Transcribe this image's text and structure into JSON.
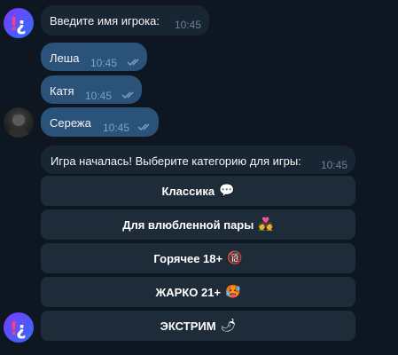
{
  "messages": {
    "prompt": {
      "text": "Введите имя игрока:",
      "time": "10:45"
    },
    "players": [
      {
        "text": "Леша",
        "time": "10:45"
      },
      {
        "text": "Катя",
        "time": "10:45"
      },
      {
        "text": "Сережа",
        "time": "10:45"
      }
    ],
    "start": {
      "text": "Игра началась! Выберите категорию для игры:",
      "time": "10:45"
    }
  },
  "keyboard": {
    "buttons": [
      {
        "label": "Классика",
        "emoji": "💬"
      },
      {
        "label": "Для влюбленной пары",
        "emoji": "💑"
      },
      {
        "label": "Горячее 18+",
        "emoji": "🔞"
      },
      {
        "label": "ЖАРКО 21+",
        "emoji": "🥵"
      },
      {
        "label": "ЭКСТРИМ",
        "emoji": "🌶"
      }
    ]
  },
  "icons": {
    "bot_avatar": "bot-logo-icon",
    "user_avatar": "user-photo-icon",
    "read_ticks": "double-check-icon"
  },
  "colors": {
    "background": "#0e1621",
    "incoming": "#182533",
    "outgoing": "#2b5278",
    "keyboard_button": "#1e2c3a",
    "bot_gradient_start": "#7b3cff",
    "bot_gradient_end": "#2f6df6"
  }
}
